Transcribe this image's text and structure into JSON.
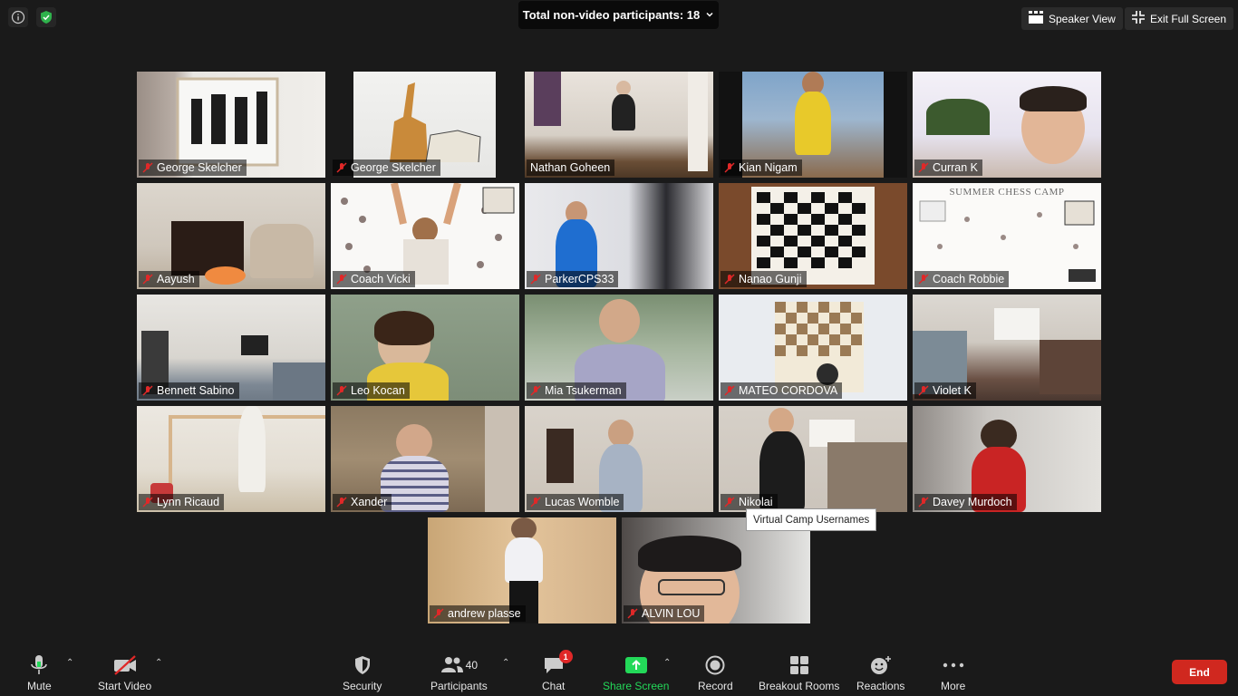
{
  "banner": {
    "text": "Total non-video participants: 18",
    "chevron": "chevron-down-icon"
  },
  "view": {
    "speaker_view": "Speaker View",
    "exit_full_screen": "Exit Full Screen"
  },
  "tiles": [
    {
      "name": "George Skelcher"
    },
    {
      "name": "George Skelcher"
    },
    {
      "name": "Nathan Goheen"
    },
    {
      "name": "Kian Nigam"
    },
    {
      "name": "Curran K"
    },
    {
      "name": "Aayush"
    },
    {
      "name": "Coach Vicki"
    },
    {
      "name": "ParkerCPS33"
    },
    {
      "name": "Nanao Gunji"
    },
    {
      "name": "Coach Robbie",
      "overlay_title": "SUMMER CHESS CAMP"
    },
    {
      "name": "Bennett Sabino"
    },
    {
      "name": "Leo Kocan"
    },
    {
      "name": "Mia Tsukerman"
    },
    {
      "name": "MATEO CORDOVA"
    },
    {
      "name": "Violet K"
    },
    {
      "name": "Lynn Ricaud"
    },
    {
      "name": "Xander"
    },
    {
      "name": "Lucas Womble"
    },
    {
      "name": "Nikolai"
    },
    {
      "name": "Davey Murdoch"
    },
    {
      "name": "andrew plasse"
    },
    {
      "name": "ALVIN LOU"
    }
  ],
  "tooltip": "Virtual Camp Usernames",
  "toolbar": {
    "mute": "Mute",
    "start_video": "Start Video",
    "security": "Security",
    "participants": "Participants",
    "participants_count": "40",
    "chat": "Chat",
    "chat_badge": "1",
    "share_screen": "Share Screen",
    "record": "Record",
    "breakout_rooms": "Breakout Rooms",
    "reactions": "Reactions",
    "more": "More",
    "end": "End"
  },
  "colors": {
    "active_speaker": "#c6e15b",
    "share": "#23d959",
    "end": "#d0281f",
    "secure": "#2fb24c"
  }
}
